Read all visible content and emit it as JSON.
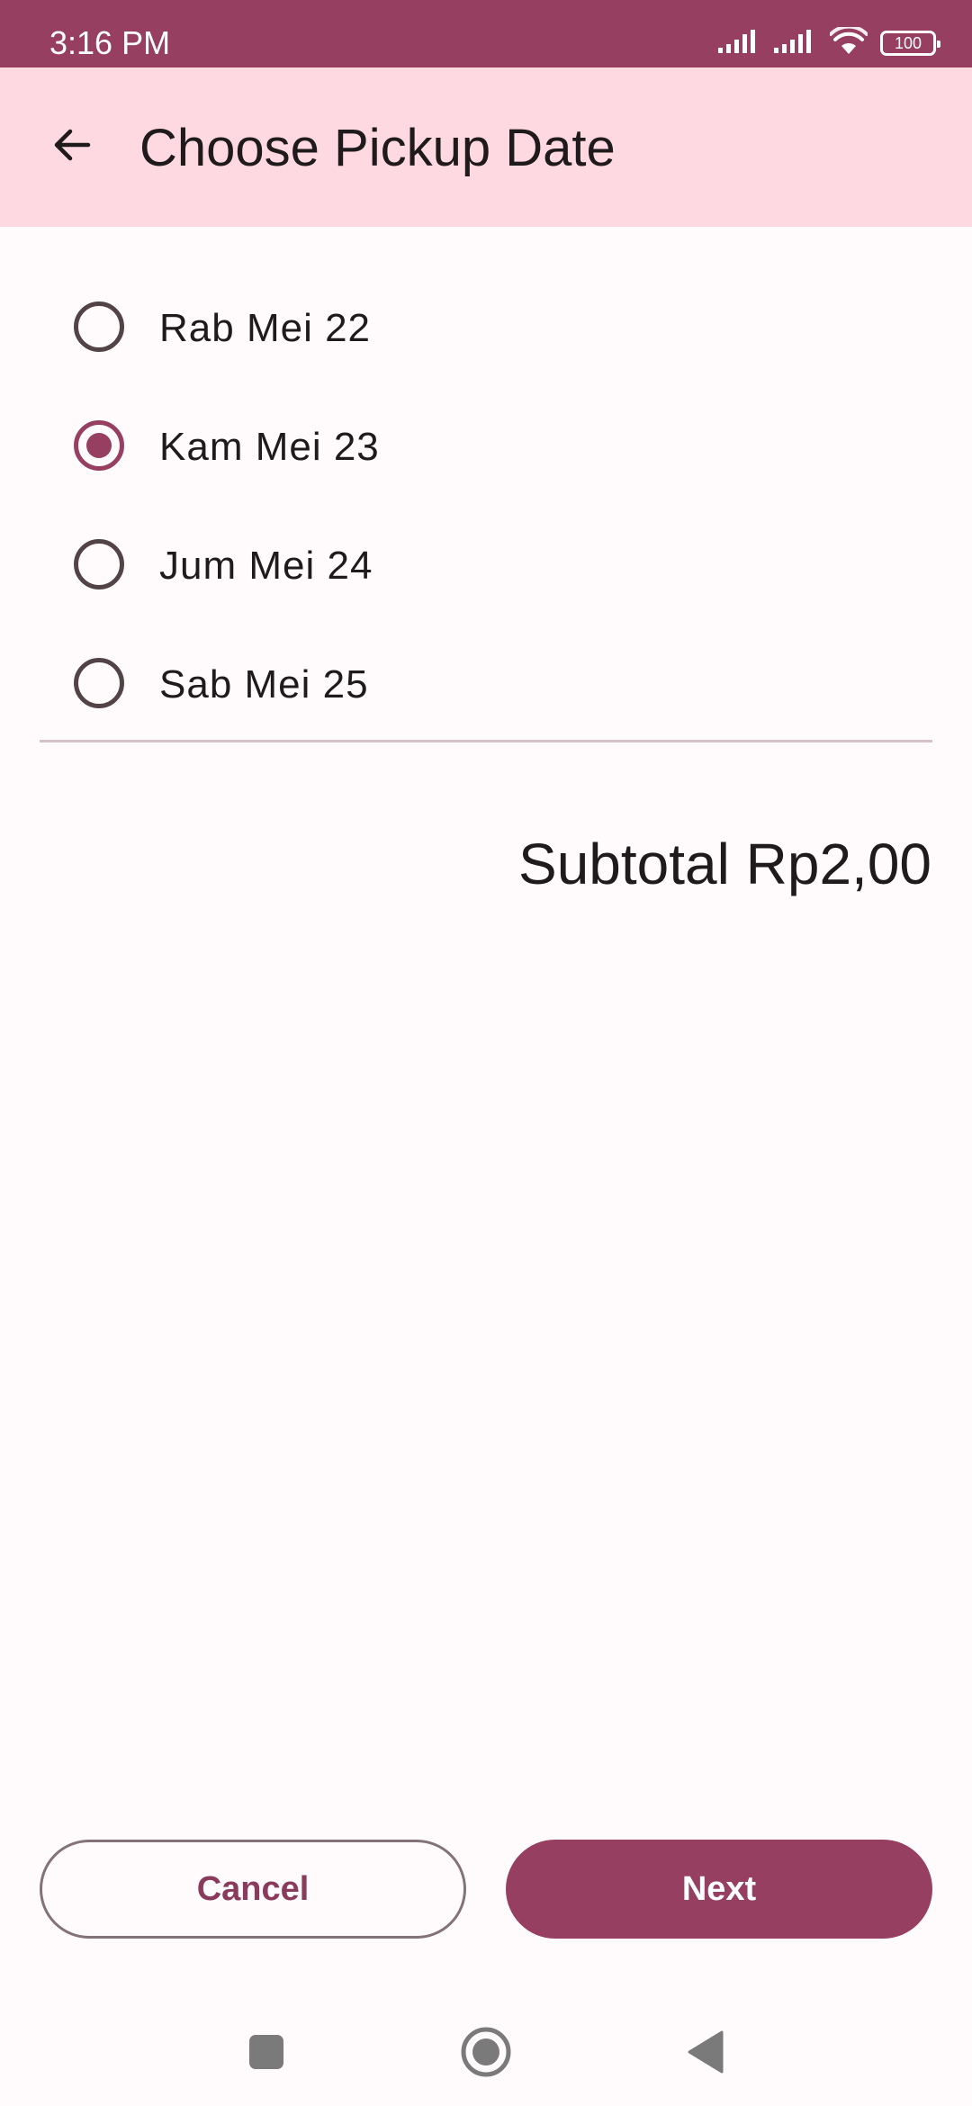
{
  "status_bar": {
    "time": "3:16 PM",
    "battery": "100",
    "icons": [
      "signal-icon",
      "signal-icon",
      "wifi-icon",
      "battery-icon"
    ]
  },
  "header": {
    "title": "Choose Pickup Date",
    "back_icon": "arrow-back-icon"
  },
  "options": [
    {
      "label": "Rab Mei 22",
      "checked": false
    },
    {
      "label": "Kam Mei 23",
      "checked": true
    },
    {
      "label": "Jum Mei 24",
      "checked": false
    },
    {
      "label": "Sab Mei 25",
      "checked": false
    }
  ],
  "summary": {
    "subtotal": "Subtotal Rp2,00"
  },
  "actions": {
    "cancel_label": "Cancel",
    "next_label": "Next"
  },
  "nav_bar": {
    "items": [
      "recents-icon",
      "home-icon",
      "back-icon"
    ]
  },
  "colors": {
    "primary": "#963f61",
    "app_bar": "#ffd9e1",
    "background": "#fffbfc",
    "text": "#1f1a1c",
    "outline": "#837377"
  }
}
